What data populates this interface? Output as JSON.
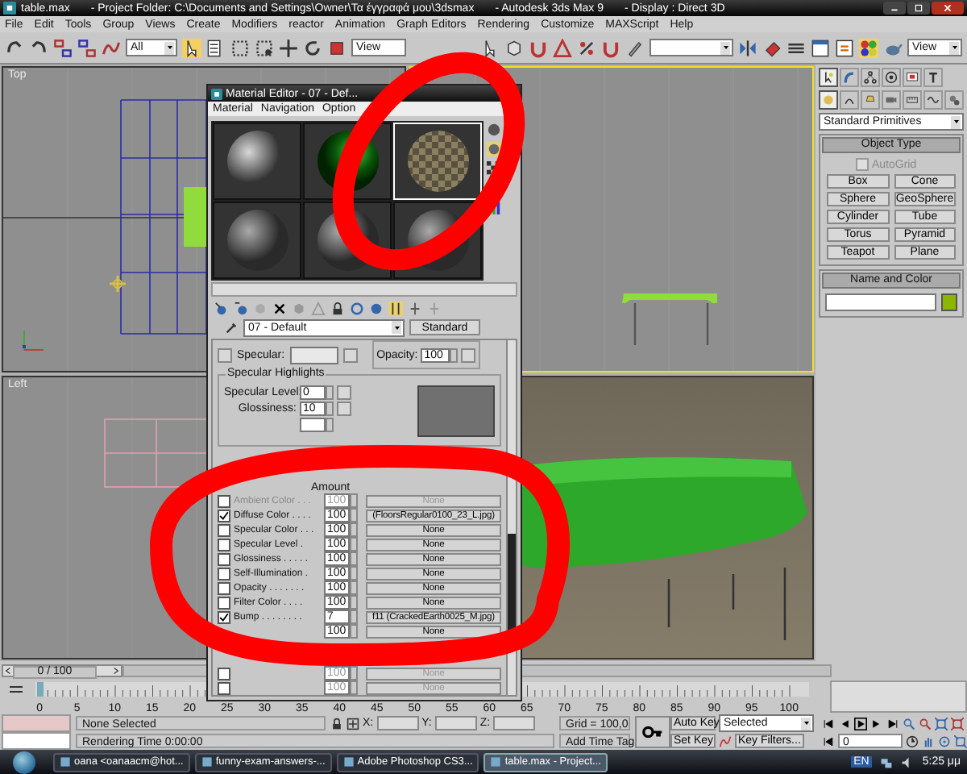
{
  "window": {
    "title_parts": [
      "table.max",
      "- Project Folder: C:\\Documents and Settings\\Owner\\Τα έγγραφά μου\\3dsmax",
      "- Autodesk 3ds Max 9",
      "- Display : Direct 3D"
    ]
  },
  "menu": [
    "File",
    "Edit",
    "Tools",
    "Group",
    "Views",
    "Create",
    "Modifiers",
    "reactor",
    "Animation",
    "Graph Editors",
    "Rendering",
    "Customize",
    "MAXScript",
    "Help"
  ],
  "toolbar": {
    "selection_filter": "All",
    "reference_coordinates": "View",
    "viewport_dropdown": "View"
  },
  "viewports": [
    {
      "kind": "top",
      "label": "Top",
      "active": false
    },
    {
      "kind": "front",
      "active": true
    },
    {
      "kind": "left",
      "label": "Left",
      "active": false
    },
    {
      "kind": "perspective",
      "active": false
    }
  ],
  "command_panel": {
    "tabs": [
      {
        "selected": true
      },
      {
        "selected": false
      },
      {
        "selected": false
      },
      {
        "selected": false
      },
      {
        "selected": false
      },
      {
        "selected": false
      }
    ],
    "categories": [
      {
        "selected": true
      },
      {
        "selected": false
      },
      {
        "selected": false
      },
      {
        "selected": false
      },
      {
        "selected": false
      },
      {
        "selected": false
      },
      {
        "selected": false
      }
    ],
    "dropdown": "Standard Primitives",
    "object_type": {
      "title": "Object Type",
      "autogrid": {
        "label": "AutoGrid",
        "checked": false,
        "disabled": true
      },
      "buttons": [
        "Box",
        "Cone",
        "Sphere",
        "GeoSphere",
        "Cylinder",
        "Tube",
        "Torus",
        "Pyramid",
        "Teapot",
        "Plane"
      ]
    },
    "name_and_color": {
      "title": "Name and Color"
    }
  },
  "material_editor": {
    "title": "Material Editor - 07 - Def...",
    "menu": [
      "Material",
      "Navigation",
      "Option"
    ],
    "slots": [
      {
        "kind": "stone",
        "selected": false
      },
      {
        "kind": "green",
        "selected": false
      },
      {
        "kind": "checker",
        "selected": true
      },
      {
        "kind": "plain",
        "selected": false
      },
      {
        "kind": "plain",
        "selected": false
      },
      {
        "kind": "plain",
        "selected": false
      }
    ],
    "material_name": "07 - Default",
    "material_type": "Standard",
    "specular_label": "Specular:",
    "opacity": {
      "label": "Opacity:",
      "value": "100"
    },
    "highlights": {
      "title": "Specular Highlights",
      "rows": [
        {
          "label": "Specular Level:",
          "value": "0"
        },
        {
          "label": "Glossiness:",
          "value": "10"
        }
      ]
    },
    "maps": {
      "amount_heading": "Amount",
      "rows": [
        {
          "label": "Ambient Color . . .",
          "checked": false,
          "amount": "100",
          "map": "None",
          "disabled": true
        },
        {
          "label": "Diffuse Color . . . .",
          "checked": true,
          "amount": "100",
          "map": "(FloorsRegular0100_23_L.jpg)",
          "disabled": false
        },
        {
          "label": "Specular Color . . .",
          "checked": false,
          "amount": "100",
          "map": "None",
          "disabled": false
        },
        {
          "label": "Specular Level .",
          "checked": false,
          "amount": "100",
          "map": "None",
          "disabled": false
        },
        {
          "label": "Glossiness . . . . .",
          "checked": false,
          "amount": "100",
          "map": "None",
          "disabled": false
        },
        {
          "label": "Self-Illumination .",
          "checked": false,
          "amount": "100",
          "map": "None",
          "disabled": false
        },
        {
          "label": "Opacity . . . . . . .",
          "checked": false,
          "amount": "100",
          "map": "None",
          "disabled": false
        },
        {
          "label": "Filter Color . . . .",
          "checked": false,
          "amount": "100",
          "map": "None",
          "disabled": false
        },
        {
          "label": "Bump . . . . . . . .",
          "checked": true,
          "amount": "7",
          "map": "f11 (CrackedEarth0025_M.jpg)",
          "disabled": false
        },
        {
          "amount": "100",
          "map": "None",
          "disabled": false
        },
        {
          "kind": "hidden"
        },
        {
          "kind": "hidden"
        },
        {
          "checked": false,
          "amount": "100",
          "map": "None",
          "disabled": true
        },
        {
          "checked": false,
          "amount": "100",
          "map": "None",
          "disabled": true
        }
      ]
    }
  },
  "timeline": {
    "slider_label": "0 / 100",
    "ticks": [
      "0",
      "5",
      "10",
      "15",
      "20",
      "25",
      "30",
      "35",
      "40",
      "45",
      "50",
      "55",
      "60",
      "65",
      "70",
      "75",
      "80",
      "85",
      "90",
      "95",
      "100"
    ]
  },
  "status": {
    "selection": "None Selected",
    "x_label": "X:",
    "y_label": "Y:",
    "z_label": "Z:",
    "grid": "Grid = 100,0",
    "rendering_time": "Rendering Time  0:00:00",
    "add_time_tag": "Add Time Tag",
    "auto_key": "Auto Key",
    "key_mode": "Selected",
    "set_key": "Set Key",
    "key_filters": "Key Filters...",
    "frame": "0"
  },
  "taskbar": {
    "items": [
      {
        "label": "oana <oanaacm@hot...",
        "selected": false
      },
      {
        "label": "funny-exam-answers-...",
        "selected": false
      },
      {
        "label": "Adobe Photoshop CS3...",
        "selected": false
      },
      {
        "label": "table.max    - Project...",
        "selected": true
      }
    ],
    "language": "EN",
    "clock": "5:25 μμ"
  }
}
